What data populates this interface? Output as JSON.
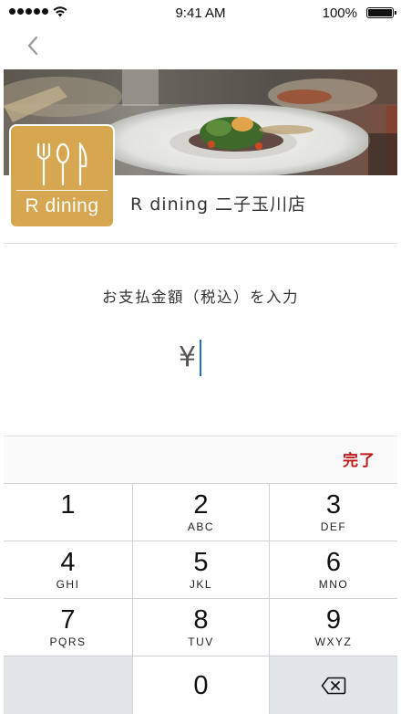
{
  "status_bar": {
    "time": "9:41 AM",
    "battery": "100%",
    "battery_level": 1.0
  },
  "nav": {
    "back_icon": "chevron-left-icon"
  },
  "store": {
    "logo_text": "R dining",
    "name": "R dining 二子玉川店"
  },
  "payment": {
    "prompt": "お支払金額（税込）を入力",
    "currency_symbol": "¥",
    "amount": ""
  },
  "keyboard": {
    "done_label": "完了",
    "keys": [
      {
        "num": "1",
        "letters": ""
      },
      {
        "num": "2",
        "letters": "ABC"
      },
      {
        "num": "3",
        "letters": "DEF"
      },
      {
        "num": "4",
        "letters": "GHI"
      },
      {
        "num": "5",
        "letters": "JKL"
      },
      {
        "num": "6",
        "letters": "MNO"
      },
      {
        "num": "7",
        "letters": "PQRS"
      },
      {
        "num": "8",
        "letters": "TUV"
      },
      {
        "num": "9",
        "letters": "WXYZ"
      },
      {
        "num": "0",
        "letters": ""
      }
    ],
    "delete_icon": "backspace-icon"
  },
  "colors": {
    "accent": "#c01818",
    "logo_bg": "#d6a750",
    "caret": "#1a73c8"
  }
}
